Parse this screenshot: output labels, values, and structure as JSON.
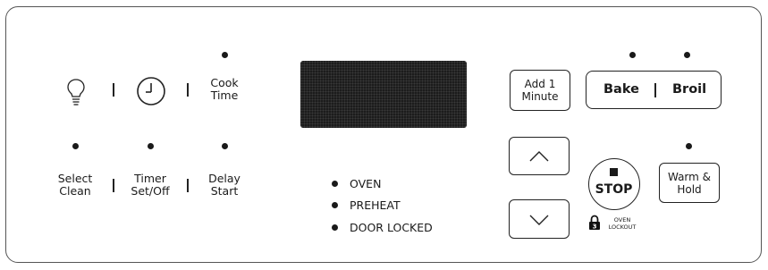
{
  "cook_time": {
    "line1": "Cook",
    "line2": "Time"
  },
  "select_clean": {
    "line1": "Select",
    "line2": "Clean"
  },
  "timer": {
    "line1": "Timer",
    "line2": "Set/Off"
  },
  "delay_start": {
    "line1": "Delay",
    "line2": "Start"
  },
  "add_minute": {
    "line1": "Add 1",
    "line2": "Minute"
  },
  "bake_label": "Bake",
  "broil_label": "Broil",
  "stop_label": "STOP",
  "warm_hold": {
    "line1": "Warm &",
    "line2": "Hold"
  },
  "lockout": {
    "line1": "OVEN",
    "line2": "LOCKOUT"
  },
  "status": {
    "oven": "OVEN",
    "preheat": "PREHEAT",
    "door_locked": "DOOR LOCKED"
  },
  "icons": [
    "light-bulb-icon",
    "clock-icon",
    "lock-icon",
    "up-arrow-icon",
    "down-arrow-icon"
  ]
}
